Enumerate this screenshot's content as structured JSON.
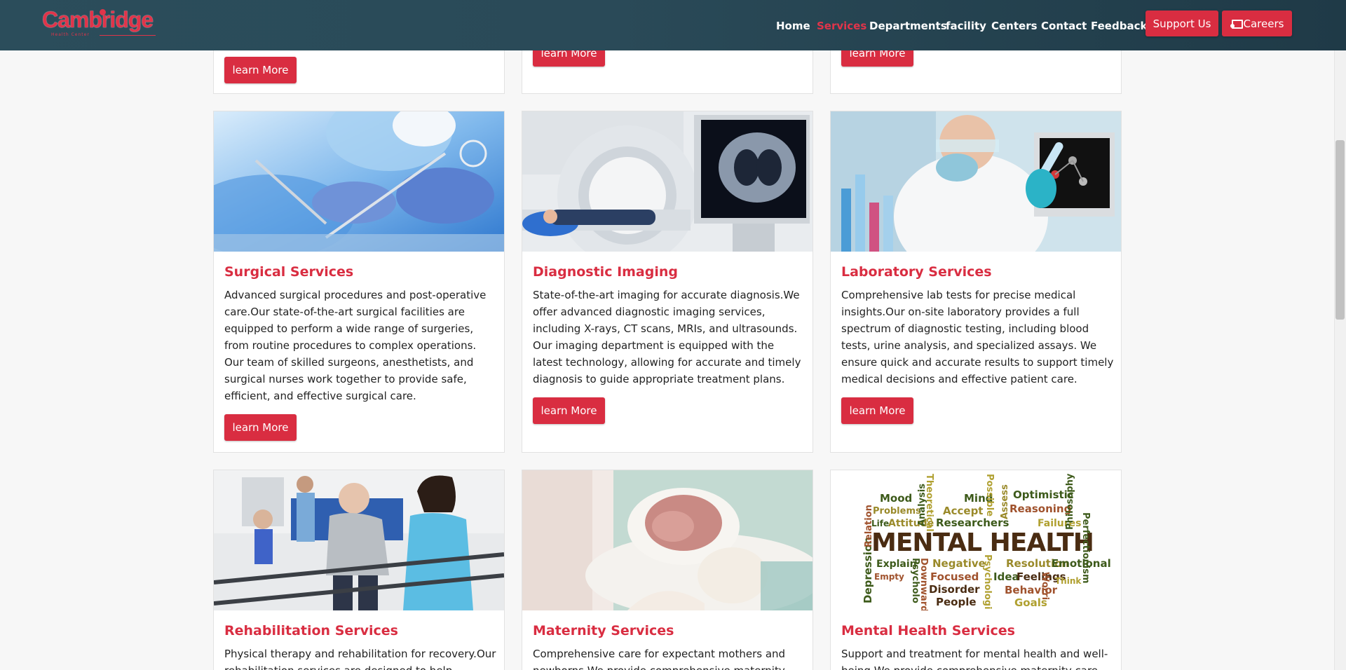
{
  "brand": {
    "name": "Cambridge",
    "tagline": "Health Center",
    "accent_color": "#d92d41",
    "header_color": "#2b4d5b"
  },
  "nav": {
    "items": [
      {
        "label": "Home",
        "active": false
      },
      {
        "label": "Services",
        "active": true
      },
      {
        "label": "Departments",
        "active": false
      },
      {
        "label": "facility",
        "active": false
      },
      {
        "label": "Centers",
        "active": false
      },
      {
        "label": "Contact",
        "active": false
      },
      {
        "label": "Feedback",
        "active": false
      }
    ],
    "support_label": "Support Us",
    "careers_label": "Careers"
  },
  "services": {
    "learn_more_label": "learn More",
    "cards": [
      {
        "title": "Surgical Services",
        "description": "Advanced surgical procedures and post-operative care.Our state-of-the-art surgical facilities are equipped to perform a wide range of surgeries, from routine procedures to complex operations. Our team of skilled surgeons, anesthetists, and surgical nurses work together to provide safe, efficient, and effective surgical care.",
        "image": "surgery-photo"
      },
      {
        "title": "Diagnostic Imaging",
        "description": "State-of-the-art imaging for accurate diagnosis.We offer advanced diagnostic imaging services, including X-rays, CT scans, MRIs, and ultrasounds. Our imaging department is equipped with the latest technology, allowing for accurate and timely diagnosis to guide appropriate treatment plans.",
        "image": "ct-scanner-photo"
      },
      {
        "title": "Laboratory Services",
        "description": "Comprehensive lab tests for precise medical insights.Our on-site laboratory provides a full spectrum of diagnostic testing, including blood tests, urine analysis, and specialized assays. We ensure quick and accurate results to support timely medical decisions and effective patient care.",
        "image": "laboratory-photo"
      },
      {
        "title": "Rehabilitation Services",
        "description": "Physical therapy and rehabilitation for recovery.Our rehabilitation services are designed to help patients",
        "image": "rehabilitation-photo"
      },
      {
        "title": "Maternity Services",
        "description": "Comprehensive care for expectant mothers and newborns.We provide comprehensive maternity care",
        "image": "newborn-photo"
      },
      {
        "title": "Mental Health Services",
        "description": "Support and treatment for mental health and well-being.We provide comprehensive maternity care",
        "image": "mental-health-wordcloud"
      }
    ]
  },
  "wordcloud": {
    "main": "MENTAL HEALTH",
    "words": [
      "Mood",
      "Problems",
      "Life",
      "Attitude",
      "Analysis",
      "Theoretical",
      "Mind",
      "Accept",
      "Researchers",
      "Possible",
      "Assess",
      "Optimistic",
      "Reasoning",
      "Failures",
      "Philosophy",
      "Perfectionism",
      "Depression",
      "Relation",
      "Explain",
      "Empty",
      "Psycholo",
      "Downward",
      "Negative",
      "Focused",
      "Disorder",
      "People",
      "Psychologi",
      "Resolution",
      "Idea",
      "Behavior",
      "Feelings",
      "Goals",
      "Emotional",
      "Think",
      "Worri"
    ]
  }
}
